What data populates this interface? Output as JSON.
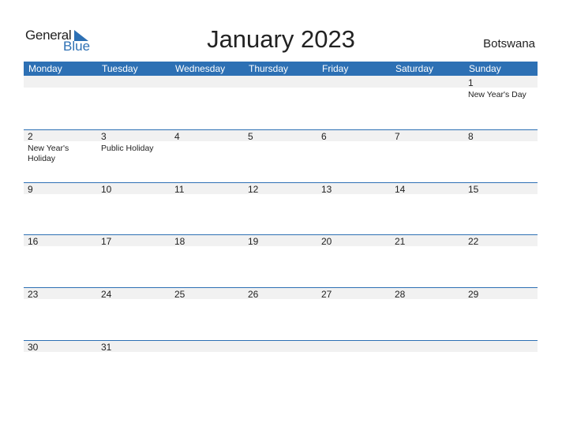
{
  "logo": {
    "general": "General",
    "blue": "Blue"
  },
  "title": "January 2023",
  "country": "Botswana",
  "colors": {
    "accent": "#2d70b4",
    "band": "#f1f1f1"
  },
  "weekdays": [
    "Monday",
    "Tuesday",
    "Wednesday",
    "Thursday",
    "Friday",
    "Saturday",
    "Sunday"
  ],
  "weeks": [
    [
      {
        "day": ""
      },
      {
        "day": ""
      },
      {
        "day": ""
      },
      {
        "day": ""
      },
      {
        "day": ""
      },
      {
        "day": ""
      },
      {
        "day": "1",
        "holiday": "New Year's Day"
      }
    ],
    [
      {
        "day": "2",
        "holiday": "New Year's Holiday"
      },
      {
        "day": "3",
        "holiday": "Public Holiday"
      },
      {
        "day": "4"
      },
      {
        "day": "5"
      },
      {
        "day": "6"
      },
      {
        "day": "7"
      },
      {
        "day": "8"
      }
    ],
    [
      {
        "day": "9"
      },
      {
        "day": "10"
      },
      {
        "day": "11"
      },
      {
        "day": "12"
      },
      {
        "day": "13"
      },
      {
        "day": "14"
      },
      {
        "day": "15"
      }
    ],
    [
      {
        "day": "16"
      },
      {
        "day": "17"
      },
      {
        "day": "18"
      },
      {
        "day": "19"
      },
      {
        "day": "20"
      },
      {
        "day": "21"
      },
      {
        "day": "22"
      }
    ],
    [
      {
        "day": "23"
      },
      {
        "day": "24"
      },
      {
        "day": "25"
      },
      {
        "day": "26"
      },
      {
        "day": "27"
      },
      {
        "day": "28"
      },
      {
        "day": "29"
      }
    ],
    [
      {
        "day": "30"
      },
      {
        "day": "31"
      },
      {
        "day": ""
      },
      {
        "day": ""
      },
      {
        "day": ""
      },
      {
        "day": ""
      },
      {
        "day": ""
      }
    ]
  ]
}
